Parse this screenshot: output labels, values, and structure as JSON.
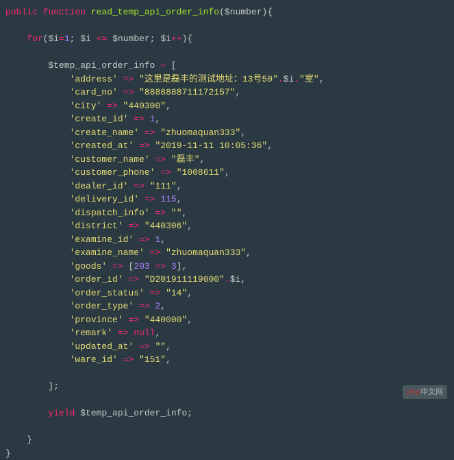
{
  "code": {
    "fn_decl": {
      "public": "public",
      "function": "function",
      "name": "read_temp_api_order_info",
      "param": "$number"
    },
    "for_line": {
      "for": "for",
      "init_var": "$i",
      "init_eq": "=",
      "init_val": "1",
      "cond_var": "$i",
      "cond_op": "<=",
      "cond_rhs": "$number",
      "post_var": "$i",
      "post_op": "++"
    },
    "assign": {
      "var": "$temp_api_order_info",
      "eq": "="
    },
    "entries": [
      {
        "key": "'address'",
        "value_parts": [
          "str:\"这里是磊丰的测试地址：13号50\"",
          "op:.",
          "var:$i",
          "op:.",
          "str:\"室\""
        ],
        "comma": ","
      },
      {
        "key": "'card_no'",
        "value_parts": [
          "str:\"8888888711172157\""
        ],
        "comma": ","
      },
      {
        "key": "'city'",
        "value_parts": [
          "str:\"440300\""
        ],
        "comma": ","
      },
      {
        "key": "'create_id'",
        "value_parts": [
          "num:1"
        ],
        "comma": ","
      },
      {
        "key": "'create_name'",
        "value_parts": [
          "str:\"zhuomaquan333\""
        ],
        "comma": ","
      },
      {
        "key": "'created_at'",
        "value_parts": [
          "str:\"2019-11-11 10:05:36\""
        ],
        "comma": ","
      },
      {
        "key": "'customer_name'",
        "value_parts": [
          "str:\"磊丰\""
        ],
        "comma": ","
      },
      {
        "key": "'customer_phone'",
        "value_parts": [
          "str:\"1008611\""
        ],
        "comma": ","
      },
      {
        "key": "'dealer_id'",
        "value_parts": [
          "str:\"111\""
        ],
        "comma": ","
      },
      {
        "key": "'delivery_id'",
        "value_parts": [
          "num:115"
        ],
        "comma": ","
      },
      {
        "key": "'dispatch_info'",
        "value_parts": [
          "str:\"\""
        ],
        "comma": ","
      },
      {
        "key": "'district'",
        "value_parts": [
          "str:\"440306\""
        ],
        "comma": ","
      },
      {
        "key": "'examine_id'",
        "value_parts": [
          "num:1"
        ],
        "comma": ","
      },
      {
        "key": "'examine_name'",
        "value_parts": [
          "str:\"zhuomaquan333\""
        ],
        "comma": ","
      },
      {
        "key": "'goods'",
        "value_parts": [
          "punct:[",
          "num:203",
          "arrow: => ",
          "num:3",
          "punct:]"
        ],
        "comma": ","
      },
      {
        "key": "'order_id'",
        "value_parts": [
          "str:\"D201911119000\"",
          "op:.",
          "var:$i"
        ],
        "comma": ","
      },
      {
        "key": "'order_status'",
        "value_parts": [
          "str:\"14\""
        ],
        "comma": ","
      },
      {
        "key": "'order_type'",
        "value_parts": [
          "num:2"
        ],
        "comma": ","
      },
      {
        "key": "'province'",
        "value_parts": [
          "str:\"440000\""
        ],
        "comma": ","
      },
      {
        "key": "'remark'",
        "value_parts": [
          "null:null"
        ],
        "comma": ","
      },
      {
        "key": "'updated_at'",
        "value_parts": [
          "str:\"\""
        ],
        "comma": ","
      },
      {
        "key": "'ware_id'",
        "value_parts": [
          "str:\"151\""
        ],
        "comma": ","
      }
    ],
    "yield": {
      "kw": "yield",
      "var": "$temp_api_order_info"
    }
  },
  "watermark": {
    "brand": "php",
    "suffix": "中文网"
  }
}
